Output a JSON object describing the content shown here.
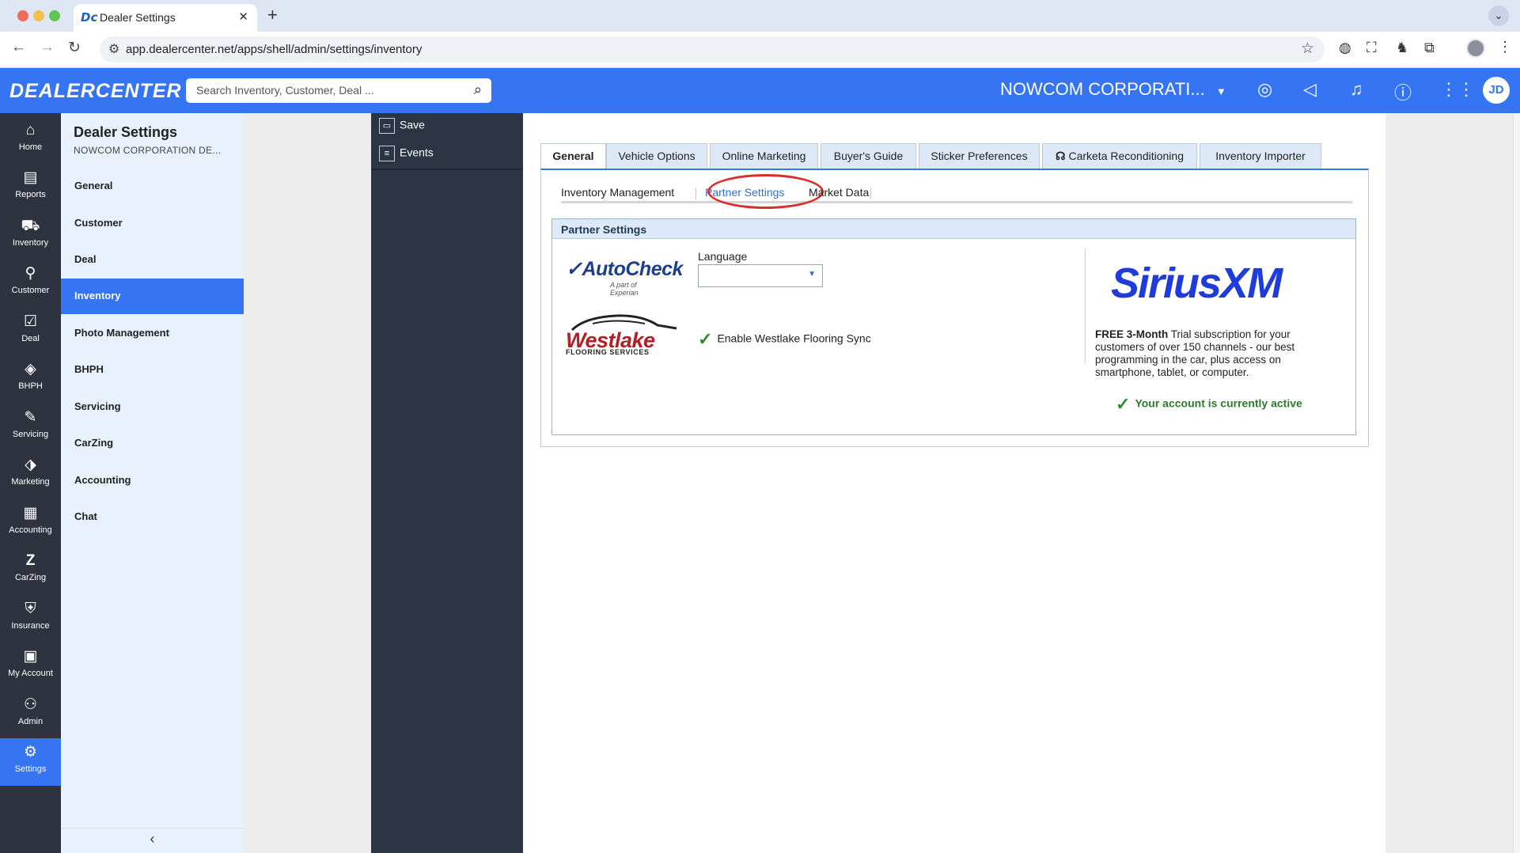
{
  "browser": {
    "tab_title": "Dealer Settings",
    "tab_favicon": "Dc",
    "url": "app.dealercenter.net/apps/shell/admin/settings/inventory"
  },
  "header": {
    "logo": "DEALERCENTER",
    "search_placeholder": "Search Inventory, Customer, Deal ...",
    "company": "NOWCOM CORPORATI...",
    "avatar_initials": "JD"
  },
  "leftnav": {
    "items": [
      {
        "label": "Home",
        "icon": "home-icon"
      },
      {
        "label": "Reports",
        "icon": "reports-icon"
      },
      {
        "label": "Inventory",
        "icon": "car-icon"
      },
      {
        "label": "Customer",
        "icon": "person-icon"
      },
      {
        "label": "Deal",
        "icon": "deal-icon"
      },
      {
        "label": "BHPH",
        "icon": "bhph-icon"
      },
      {
        "label": "Servicing",
        "icon": "wrench-icon"
      },
      {
        "label": "Marketing",
        "icon": "tag-icon"
      },
      {
        "label": "Accounting",
        "icon": "calculator-icon"
      },
      {
        "label": "CarZing",
        "icon": "carzing-icon"
      },
      {
        "label": "Insurance",
        "icon": "shield-icon"
      },
      {
        "label": "My Account",
        "icon": "account-icon"
      },
      {
        "label": "Admin",
        "icon": "admin-icon"
      },
      {
        "label": "Settings",
        "icon": "gear-icon"
      }
    ],
    "active": "Settings"
  },
  "settings_sidebar": {
    "title": "Dealer Settings",
    "subtitle": "NOWCOM CORPORATION DE...",
    "items": [
      "General",
      "Customer",
      "Deal",
      "Inventory",
      "Photo Management",
      "BHPH",
      "Servicing",
      "CarZing",
      "Accounting",
      "Chat"
    ],
    "active": "Inventory"
  },
  "toolbar": {
    "save_label": "Save",
    "events_label": "Events"
  },
  "main_tabs": {
    "items": [
      "General",
      "Vehicle Options",
      "Online Marketing",
      "Buyer's Guide",
      "Sticker Preferences",
      "Carketa Reconditioning",
      "Inventory Importer"
    ],
    "active": "General"
  },
  "sub_tabs": {
    "items": [
      "Inventory Management",
      "Partner Settings",
      "Market Data"
    ],
    "active": "Partner Settings"
  },
  "partner_settings": {
    "header": "Partner Settings",
    "autocheck_logo": "AutoCheck",
    "autocheck_sub": "A part of Experian",
    "westlake_logo": "Westlake",
    "westlake_sub": "FLOORING SERVICES",
    "language_label": "Language",
    "language_value": "",
    "westlake_checkbox_label": "Enable Westlake Flooring Sync",
    "sirius_logo": "SiriusXM",
    "sirius_bold": "FREE 3-Month",
    "sirius_text": " Trial subscription for your customers of over 150 channels - our best programming in the car, plus access on smartphone, tablet, or computer.",
    "active_message": "Your account is currently active"
  },
  "colors": {
    "brand_blue": "#3574f3",
    "nav_dark": "#2d3440",
    "sidebar_bg": "#e9f2fc",
    "highlight_red": "#d9302b",
    "success_green": "#2c7a2c"
  }
}
